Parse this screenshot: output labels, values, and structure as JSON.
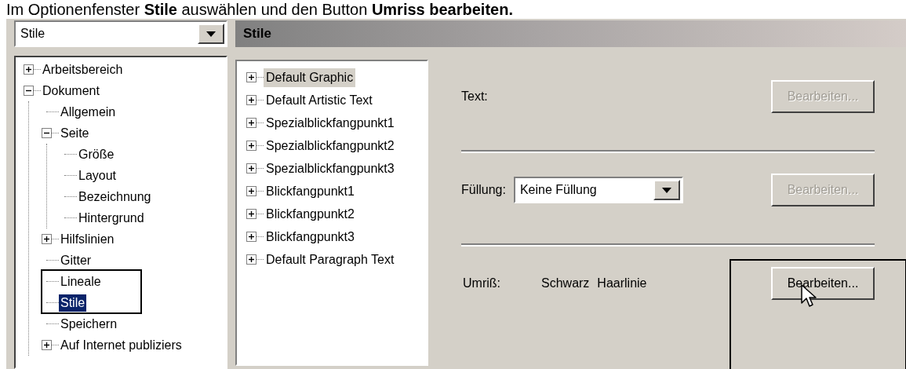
{
  "caption": "Im Optionenfenster **Stile** auswählen und den Button **Umriss bearbeiten.**",
  "category_select": {
    "value": "Stile"
  },
  "tree": [
    {
      "label": "Arbeitsbereich",
      "expanded": false,
      "selected": false
    },
    {
      "label": "Dokument",
      "expanded": true,
      "selected": false,
      "children": [
        {
          "label": "Allgemein",
          "selected": false
        },
        {
          "label": "Seite",
          "expanded": true,
          "selected": false,
          "children": [
            {
              "label": "Größe",
              "selected": false
            },
            {
              "label": "Layout",
              "selected": false
            },
            {
              "label": "Bezeichnung",
              "selected": false
            },
            {
              "label": "Hintergrund",
              "selected": false
            }
          ]
        },
        {
          "label": "Hilfslinien",
          "expanded": false,
          "selected": false
        },
        {
          "label": "Gitter",
          "selected": false
        },
        {
          "label": "Lineale",
          "selected": false
        },
        {
          "label": "Stile",
          "selected": true
        },
        {
          "label": "Speichern",
          "selected": false
        },
        {
          "label": "Auf Internet publiziers",
          "expanded": false,
          "selected": false
        }
      ]
    }
  ],
  "panel_title": "Stile",
  "styles": [
    {
      "label": "Default Graphic",
      "expanded": false,
      "selected": true
    },
    {
      "label": "Default Artistic Text",
      "expanded": false,
      "selected": false
    },
    {
      "label": "Spezialblickfangpunkt1",
      "expanded": false,
      "selected": false
    },
    {
      "label": "Spezialblickfangpunkt2",
      "expanded": false,
      "selected": false
    },
    {
      "label": "Spezialblickfangpunkt3",
      "expanded": false,
      "selected": false
    },
    {
      "label": "Blickfangpunkt1",
      "expanded": false,
      "selected": false
    },
    {
      "label": "Blickfangpunkt2",
      "expanded": false,
      "selected": false
    },
    {
      "label": "Blickfangpunkt3",
      "expanded": false,
      "selected": false
    },
    {
      "label": "Default Paragraph Text",
      "expanded": false,
      "selected": false
    }
  ],
  "properties": [
    {
      "kind": "text",
      "label": "Text:",
      "button": {
        "label": "Bearbeiten...",
        "disabled": true
      }
    },
    {
      "kind": "select",
      "label": "Füllung:",
      "value": "Keine Füllung",
      "button": {
        "label": "Bearbeiten...",
        "disabled": true
      }
    },
    {
      "kind": "values",
      "label": "Umriß:",
      "values": [
        "Schwarz",
        "Haarlinie"
      ],
      "button": {
        "label": "Bearbeiten...",
        "disabled": false
      }
    }
  ]
}
